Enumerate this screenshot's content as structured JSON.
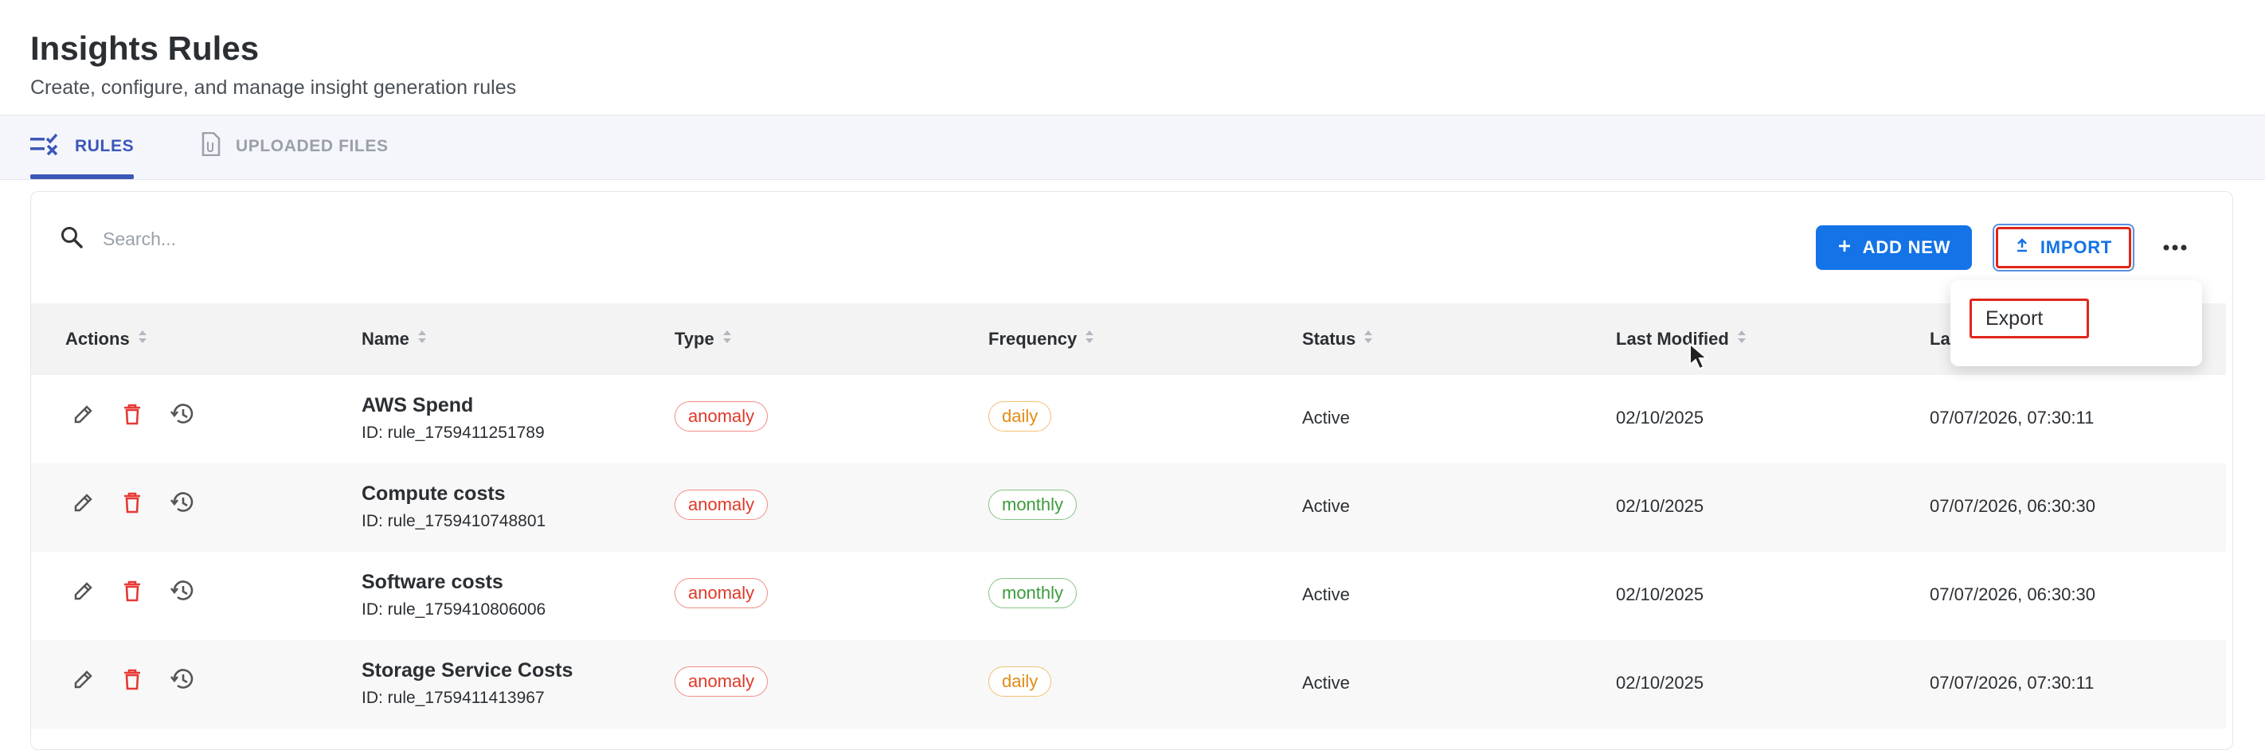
{
  "header": {
    "title": "Insights Rules",
    "subtitle": "Create, configure, and manage insight generation rules"
  },
  "tabs": [
    {
      "label": "RULES",
      "icon": "rules-checklist-icon",
      "active": true
    },
    {
      "label": "UPLOADED FILES",
      "icon": "file-icon",
      "active": false
    }
  ],
  "toolbar": {
    "search_placeholder": "Search...",
    "add_label": "ADD NEW",
    "import_label": "IMPORT"
  },
  "menu": {
    "export_label": "Export"
  },
  "table": {
    "columns": [
      "Actions",
      "Name",
      "Type",
      "Frequency",
      "Status",
      "Last Modified",
      "La"
    ],
    "rows": [
      {
        "name": "AWS Spend",
        "id": "ID: rule_1759411251789",
        "type": "anomaly",
        "frequency": "daily",
        "status": "Active",
        "last_modified": "02/10/2025",
        "last_run": "07/07/2026, 07:30:11"
      },
      {
        "name": "Compute costs",
        "id": "ID: rule_1759410748801",
        "type": "anomaly",
        "frequency": "monthly",
        "status": "Active",
        "last_modified": "02/10/2025",
        "last_run": "07/07/2026, 06:30:30"
      },
      {
        "name": "Software costs",
        "id": "ID: rule_1759410806006",
        "type": "anomaly",
        "frequency": "monthly",
        "status": "Active",
        "last_modified": "02/10/2025",
        "last_run": "07/07/2026, 06:30:30"
      },
      {
        "name": "Storage Service Costs",
        "id": "ID: rule_1759411413967",
        "type": "anomaly",
        "frequency": "daily",
        "status": "Active",
        "last_modified": "02/10/2025",
        "last_run": "07/07/2026, 07:30:11"
      }
    ]
  },
  "colors": {
    "primary": "#1473e6",
    "tab_active": "#3b57b7",
    "highlight": "#e0271a",
    "delete_icon": "#e53935",
    "chip_anomaly": "#e0392b",
    "chip_daily": "#e38a15",
    "chip_monthly": "#3c9b3c"
  }
}
